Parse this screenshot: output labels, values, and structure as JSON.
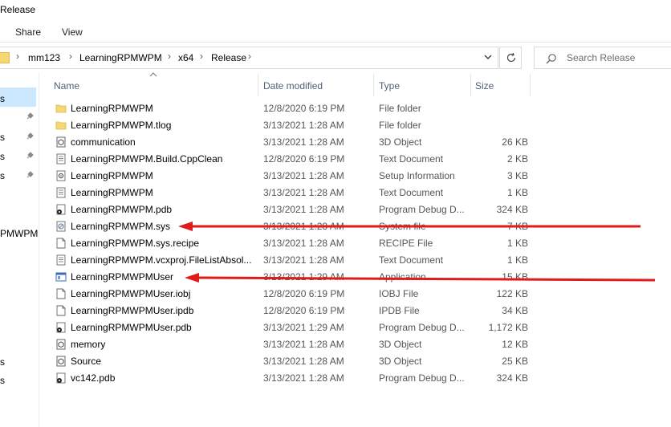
{
  "window": {
    "title": "Release"
  },
  "ribbon": {
    "tabs": [
      "Share",
      "View"
    ]
  },
  "address_bar": {
    "crumbs": [
      "mm123",
      "LearningRPMWPM",
      "x64",
      "Release"
    ]
  },
  "search": {
    "placeholder": "Search Release"
  },
  "nav_pane": {
    "fragments": [
      "s",
      "s",
      "s",
      "s",
      "PMWPM",
      "s",
      "s"
    ]
  },
  "columns": {
    "name": "Name",
    "date": "Date modified",
    "type": "Type",
    "size": "Size"
  },
  "files": [
    {
      "name": "LearningRPMWPM",
      "date": "12/8/2020 6:19 PM",
      "type": "File folder",
      "size": "",
      "icon": "folder-icon"
    },
    {
      "name": "LearningRPMWPM.tlog",
      "date": "3/13/2021 1:28 AM",
      "type": "File folder",
      "size": "",
      "icon": "folder-icon"
    },
    {
      "name": "communication",
      "date": "3/13/2021 1:28 AM",
      "type": "3D Object",
      "size": "26 KB",
      "icon": "3d-object-icon"
    },
    {
      "name": "LearningRPMWPM.Build.CppClean",
      "date": "12/8/2020 6:19 PM",
      "type": "Text Document",
      "size": "2 KB",
      "icon": "text-document-icon"
    },
    {
      "name": "LearningRPMWPM",
      "date": "3/13/2021 1:28 AM",
      "type": "Setup Information",
      "size": "3 KB",
      "icon": "setup-information-icon"
    },
    {
      "name": "LearningRPMWPM",
      "date": "3/13/2021 1:28 AM",
      "type": "Text Document",
      "size": "1 KB",
      "icon": "text-document-icon"
    },
    {
      "name": "LearningRPMWPM.pdb",
      "date": "3/13/2021 1:28 AM",
      "type": "Program Debug D...",
      "size": "324 KB",
      "icon": "debug-database-icon"
    },
    {
      "name": "LearningRPMWPM.sys",
      "date": "3/13/2021 1:28 AM",
      "type": "System file",
      "size": "7 KB",
      "icon": "system-file-icon"
    },
    {
      "name": "LearningRPMWPM.sys.recipe",
      "date": "3/13/2021 1:28 AM",
      "type": "RECIPE File",
      "size": "1 KB",
      "icon": "generic-file-icon"
    },
    {
      "name": "LearningRPMWPM.vcxproj.FileListAbsol...",
      "date": "3/13/2021 1:28 AM",
      "type": "Text Document",
      "size": "1 KB",
      "icon": "text-document-icon"
    },
    {
      "name": "LearningRPMWPMUser",
      "date": "3/13/2021 1:29 AM",
      "type": "Application",
      "size": "15 KB",
      "icon": "application-icon"
    },
    {
      "name": "LearningRPMWPMUser.iobj",
      "date": "12/8/2020 6:19 PM",
      "type": "IOBJ File",
      "size": "122 KB",
      "icon": "generic-file-icon"
    },
    {
      "name": "LearningRPMWPMUser.ipdb",
      "date": "12/8/2020 6:19 PM",
      "type": "IPDB File",
      "size": "34 KB",
      "icon": "generic-file-icon"
    },
    {
      "name": "LearningRPMWPMUser.pdb",
      "date": "3/13/2021 1:29 AM",
      "type": "Program Debug D...",
      "size": "1,172 KB",
      "icon": "debug-database-icon"
    },
    {
      "name": "memory",
      "date": "3/13/2021 1:28 AM",
      "type": "3D Object",
      "size": "12 KB",
      "icon": "3d-object-icon"
    },
    {
      "name": "Source",
      "date": "3/13/2021 1:28 AM",
      "type": "3D Object",
      "size": "25 KB",
      "icon": "3d-object-icon"
    },
    {
      "name": "vc142.pdb",
      "date": "3/13/2021 1:28 AM",
      "type": "Program Debug D...",
      "size": "324 KB",
      "icon": "debug-database-icon"
    }
  ],
  "annotation_color": "#e01b1b",
  "folder_color": "#f8d775",
  "selection_color": "#cce8ff"
}
